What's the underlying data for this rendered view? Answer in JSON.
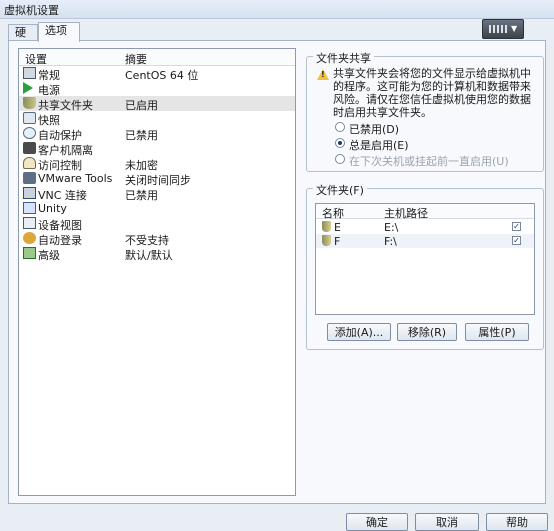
{
  "window": {
    "title": "虚拟机设置"
  },
  "tabs": [
    {
      "label": "硬件",
      "active": false
    },
    {
      "label": "选项",
      "active": true
    }
  ],
  "settings_list": {
    "header": {
      "col_setting": "设置",
      "col_summary": "摘要"
    },
    "items": [
      {
        "label": "常规",
        "summary": "CentOS 64 位",
        "icon": "general-icon"
      },
      {
        "label": "电源",
        "summary": "",
        "icon": "power-icon"
      },
      {
        "label": "共享文件夹",
        "summary": "已启用",
        "icon": "shared-folder-icon",
        "selected": true
      },
      {
        "label": "快照",
        "summary": "",
        "icon": "snapshot-icon"
      },
      {
        "label": "自动保护",
        "summary": "已禁用",
        "icon": "autoprotect-icon"
      },
      {
        "label": "客户机隔离",
        "summary": "",
        "icon": "guest-isolation-icon"
      },
      {
        "label": "访问控制",
        "summary": "未加密",
        "icon": "access-control-icon"
      },
      {
        "label": "VMware Tools",
        "summary": "关闭时间同步",
        "icon": "vmware-tools-icon"
      },
      {
        "label": "VNC 连接",
        "summary": "已禁用",
        "icon": "vnc-icon"
      },
      {
        "label": "Unity",
        "summary": "",
        "icon": "unity-icon"
      },
      {
        "label": "设备视图",
        "summary": "",
        "icon": "device-view-icon"
      },
      {
        "label": "自动登录",
        "summary": "不受支持",
        "icon": "autologin-icon"
      },
      {
        "label": "高级",
        "summary": "默认/默认",
        "icon": "advanced-icon"
      }
    ]
  },
  "folder_sharing": {
    "title": "文件夹共享",
    "warning_lines": [
      "共享文件夹会将您的文件显示给虚拟机中",
      "的程序。这可能为您的计算机和数据带来",
      "风险。请仅在您信任虚拟机使用您的数据",
      "时启用共享文件夹。"
    ],
    "options": [
      {
        "label": "已禁用(D)",
        "checked": false,
        "disabled": false
      },
      {
        "label": "总是启用(E)",
        "checked": true,
        "disabled": false
      },
      {
        "label": "在下次关机或挂起前一直启用(U)",
        "checked": false,
        "disabled": true
      }
    ]
  },
  "folders": {
    "title": "文件夹(F)",
    "header": {
      "col_name": "名称",
      "col_path": "主机路径"
    },
    "rows": [
      {
        "name": "E",
        "path": "E:\\",
        "enabled": true
      },
      {
        "name": "F",
        "path": "F:\\",
        "enabled": true
      }
    ],
    "buttons": {
      "add": "添加(A)...",
      "remove": "移除(R)",
      "properties": "属性(P)"
    }
  },
  "footer": {
    "ok": "确定",
    "cancel": "取消",
    "help": "帮助"
  }
}
